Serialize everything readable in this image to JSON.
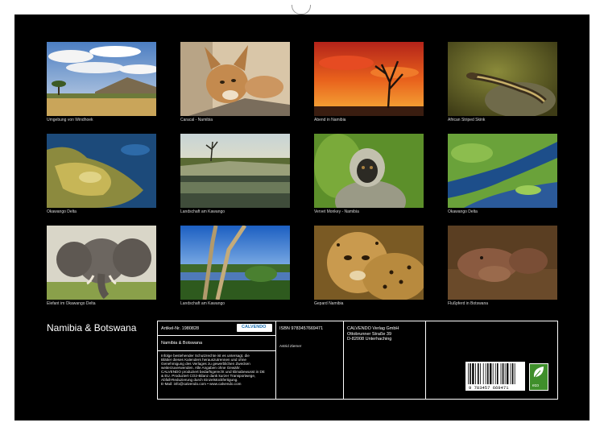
{
  "calendar": {
    "title": "Namibia & Botswana"
  },
  "photos": [
    {
      "caption": "Umgebung von Windhoek"
    },
    {
      "caption": "Caracal - Namibia"
    },
    {
      "caption": "Abend in Namibia"
    },
    {
      "caption": "African Striped Skink"
    },
    {
      "caption": "Okawango Delta"
    },
    {
      "caption": "Landschaft am Kawango"
    },
    {
      "caption": "Vervet Monkey - Namibia"
    },
    {
      "caption": "Okawango Delta"
    },
    {
      "caption": "Elefant im Okawango Delta"
    },
    {
      "caption": "Landschaft am Kawango"
    },
    {
      "caption": "Gepard Namibia"
    },
    {
      "caption": "Flußpferd in Botswana"
    }
  ],
  "info": {
    "article": "Artikel-Nr. 1980828",
    "product_title": "Namibia & Botswana",
    "isbn": "ISBN 9783457669471",
    "author": "Astrid Ziemer",
    "publisher_line1": "CALVENDO Verlag GmbH",
    "publisher_line2": "Ottobrunner Straße 39",
    "publisher_line3": "D-82008 Unterhaching",
    "legal_line1": "Infolge bestehender Schutzrechte ist es untersagt, die",
    "legal_line2": "Blätter dieses Kalenders herauszutrennen und ohne",
    "legal_line3": "Genehmigung des Verlages zu gewerblichen Zwecken",
    "legal_line4": "weiterzuverwenden. Alle Angaben ohne Gewähr.",
    "legal_line5": "CALVENDO produziert bedarfsgerecht und klimabewusst in DE",
    "legal_line6": "& EU. Produziert CO2-Bilanz dank kurzer Transportwege,",
    "legal_line7": "Abfall-Reduzierung durch Einzelstückfertigung.",
    "legal_line8": "E-Mail: info@calvendo.com • www.calvendo.com",
    "logo_text": "CALVENDO",
    "barcode_number": "9 783457 669471",
    "eco_label": "eco"
  }
}
